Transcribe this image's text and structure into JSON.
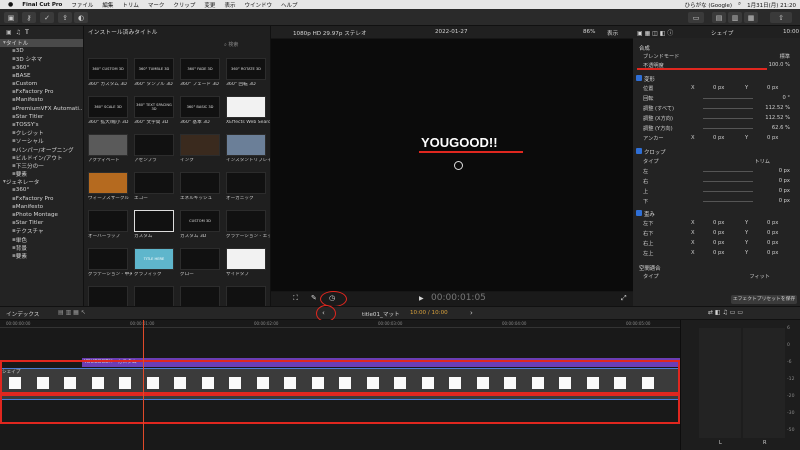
{
  "menubar": {
    "app": "Final Cut Pro",
    "items": [
      "ファイル",
      "編集",
      "トリム",
      "マーク",
      "クリップ",
      "変更",
      "表示",
      "ウインドウ",
      "ヘルプ"
    ],
    "search_label": "ひらがな (Google)",
    "clock": "1月31日(月) 21:20"
  },
  "sidebar": {
    "items": [
      {
        "label": "タイトル",
        "level": 0,
        "selected": true
      },
      {
        "label": "3D",
        "level": 1
      },
      {
        "label": "3D シネマ",
        "level": 1
      },
      {
        "label": "360°",
        "level": 1
      },
      {
        "label": "BASE",
        "level": 1
      },
      {
        "label": "Custom",
        "level": 1
      },
      {
        "label": "FxFactory Pro",
        "level": 1
      },
      {
        "label": "Manifesto",
        "level": 1
      },
      {
        "label": "PremiumVFX Automati...",
        "level": 1
      },
      {
        "label": "Star Titler",
        "level": 1
      },
      {
        "label": "TOSSY's",
        "level": 1
      },
      {
        "label": "クレジット",
        "level": 1
      },
      {
        "label": "ソーシャル",
        "level": 1
      },
      {
        "label": "バンパー/オープニング",
        "level": 1
      },
      {
        "label": "ビルドイン/アウト",
        "level": 1
      },
      {
        "label": "下三分の一",
        "level": 1
      },
      {
        "label": "要素",
        "level": 1
      },
      {
        "label": "ジェネレータ",
        "level": 0
      },
      {
        "label": "360°",
        "level": 1
      },
      {
        "label": "FxFactory Pro",
        "level": 1
      },
      {
        "label": "Manifesto",
        "level": 1
      },
      {
        "label": "Photo Montage",
        "level": 1
      },
      {
        "label": "Star Titler",
        "level": 1
      },
      {
        "label": "テクスチャ",
        "level": 1
      },
      {
        "label": "単色",
        "level": 1
      },
      {
        "label": "背景",
        "level": 1
      },
      {
        "label": "要素",
        "level": 1
      }
    ]
  },
  "browser": {
    "title": "インストール済みタイトル",
    "search_placeholder": "検索",
    "tiles": [
      {
        "label": "360° カスタム 3D",
        "thumb": "360° CUSTOM 3D"
      },
      {
        "label": "360° タンブル 3D",
        "thumb": "360° TUMBLE 3D"
      },
      {
        "label": "360° フェード 3D",
        "thumb": "360° FADE 3D"
      },
      {
        "label": "360° 回転 3D",
        "thumb": "360° ROTATE 3D"
      },
      {
        "label": "360° 拡大/縮小 3D",
        "thumb": "360° SCALE 3D"
      },
      {
        "label": "360° 文字間 3D",
        "thumb": "360° TEXT SPACING 3D"
      },
      {
        "label": "360° 基本 3D",
        "thumb": "360° BASIC 3D"
      },
      {
        "label": "XEffects Web Search Page",
        "thumb": ""
      },
      {
        "label": "アクティベート",
        "thumb": ""
      },
      {
        "label": "アセンブラ",
        "thumb": ""
      },
      {
        "label": "インク",
        "thumb": ""
      },
      {
        "label": "インスタントリプレイ",
        "thumb": ""
      },
      {
        "label": "ウィーブスサークル",
        "thumb": ""
      },
      {
        "label": "エコー",
        "thumb": ""
      },
      {
        "label": "エネルギッシュ",
        "thumb": ""
      },
      {
        "label": "オーガニック",
        "thumb": ""
      },
      {
        "label": "オーバーラップ",
        "thumb": ""
      },
      {
        "label": "カスタム",
        "thumb": ""
      },
      {
        "label": "カスタム 3D",
        "thumb": "CUSTOM 3D"
      },
      {
        "label": "グラデーション - エッジ",
        "thumb": ""
      },
      {
        "label": "グラデーション - 中央",
        "thumb": ""
      },
      {
        "label": "グラフィック",
        "thumb": "TITLE HERE"
      },
      {
        "label": "グロー",
        "thumb": ""
      },
      {
        "label": "サイドタブ",
        "thumb": ""
      },
      {
        "label": "",
        "thumb": ""
      },
      {
        "label": "",
        "thumb": ""
      },
      {
        "label": "",
        "thumb": ""
      },
      {
        "label": "",
        "thumb": ""
      }
    ]
  },
  "viewer": {
    "format": "1080p HD 29.97p ステレオ",
    "project_date": "2022-01-27",
    "zoom": "86%",
    "view_menu": "表示",
    "title_text": "YOUGOOD!!",
    "timecode": "00:00:01:05"
  },
  "inspector": {
    "title": "シェイプ",
    "duration": "10:00",
    "composite_header": "合成",
    "blend_mode_label": "ブレンドモード",
    "blend_mode_value": "標準",
    "opacity_label": "不透明度",
    "opacity_value": "100.0 %",
    "transform": {
      "header": "変形",
      "rows": [
        {
          "label": "位置",
          "x": "X",
          "xv": "0 px",
          "y": "Y",
          "yv": "0 px"
        },
        {
          "label": "回転",
          "value": "0 °"
        },
        {
          "label": "調整 (すべて)",
          "value": "112.52 %"
        },
        {
          "label": "調整 (X方向)",
          "value": "112.52 %"
        },
        {
          "label": "調整 (Y方向)",
          "value": "62.6 %"
        },
        {
          "label": "アンカー",
          "x": "X",
          "xv": "0 px",
          "y": "Y",
          "yv": "0 px"
        }
      ]
    },
    "crop": {
      "header": "クロップ",
      "type_label": "タイプ",
      "type_value": "トリム",
      "rows": [
        {
          "label": "左",
          "value": "0 px"
        },
        {
          "label": "右",
          "value": "0 px"
        },
        {
          "label": "上",
          "value": "0 px"
        },
        {
          "label": "下",
          "value": "0 px"
        }
      ]
    },
    "distort": {
      "header": "歪み",
      "rows": [
        {
          "label": "左下",
          "x": "X",
          "xv": "0 px",
          "y": "Y",
          "yv": "0 px"
        },
        {
          "label": "右下",
          "x": "X",
          "xv": "0 px",
          "y": "Y",
          "yv": "0 px"
        },
        {
          "label": "右上",
          "x": "X",
          "xv": "0 px",
          "y": "Y",
          "yv": "0 px"
        },
        {
          "label": "左上",
          "x": "X",
          "xv": "0 px",
          "y": "Y",
          "yv": "0 px"
        }
      ]
    },
    "conform": {
      "header": "空間適合",
      "type_label": "タイプ",
      "type_value": "フィット"
    },
    "save_preset": "エフェクトプリセットを保存"
  },
  "timeline": {
    "index_label": "インデックス",
    "clip_name": "title01_マット",
    "clip_time": "10:00 / 10:00",
    "ruler": [
      "00:00:00:00",
      "00:00:01:00",
      "00:00:02:00",
      "00:00:03:00",
      "00:00:04:00",
      "00:00:05:00"
    ],
    "title_clip_label": "YOUGOOD!! - カスタム",
    "shape_clip_label": "シェイプ"
  },
  "meters": {
    "scale": [
      "6",
      "0",
      "-6",
      "-12",
      "-20",
      "-30",
      "-50"
    ],
    "channels": [
      "L",
      "R"
    ]
  },
  "colors": {
    "accent": "#2f6fd6",
    "annotation_red": "#e0271f",
    "title_clip": "#6c3db5",
    "playhead": "#e04a2a"
  }
}
